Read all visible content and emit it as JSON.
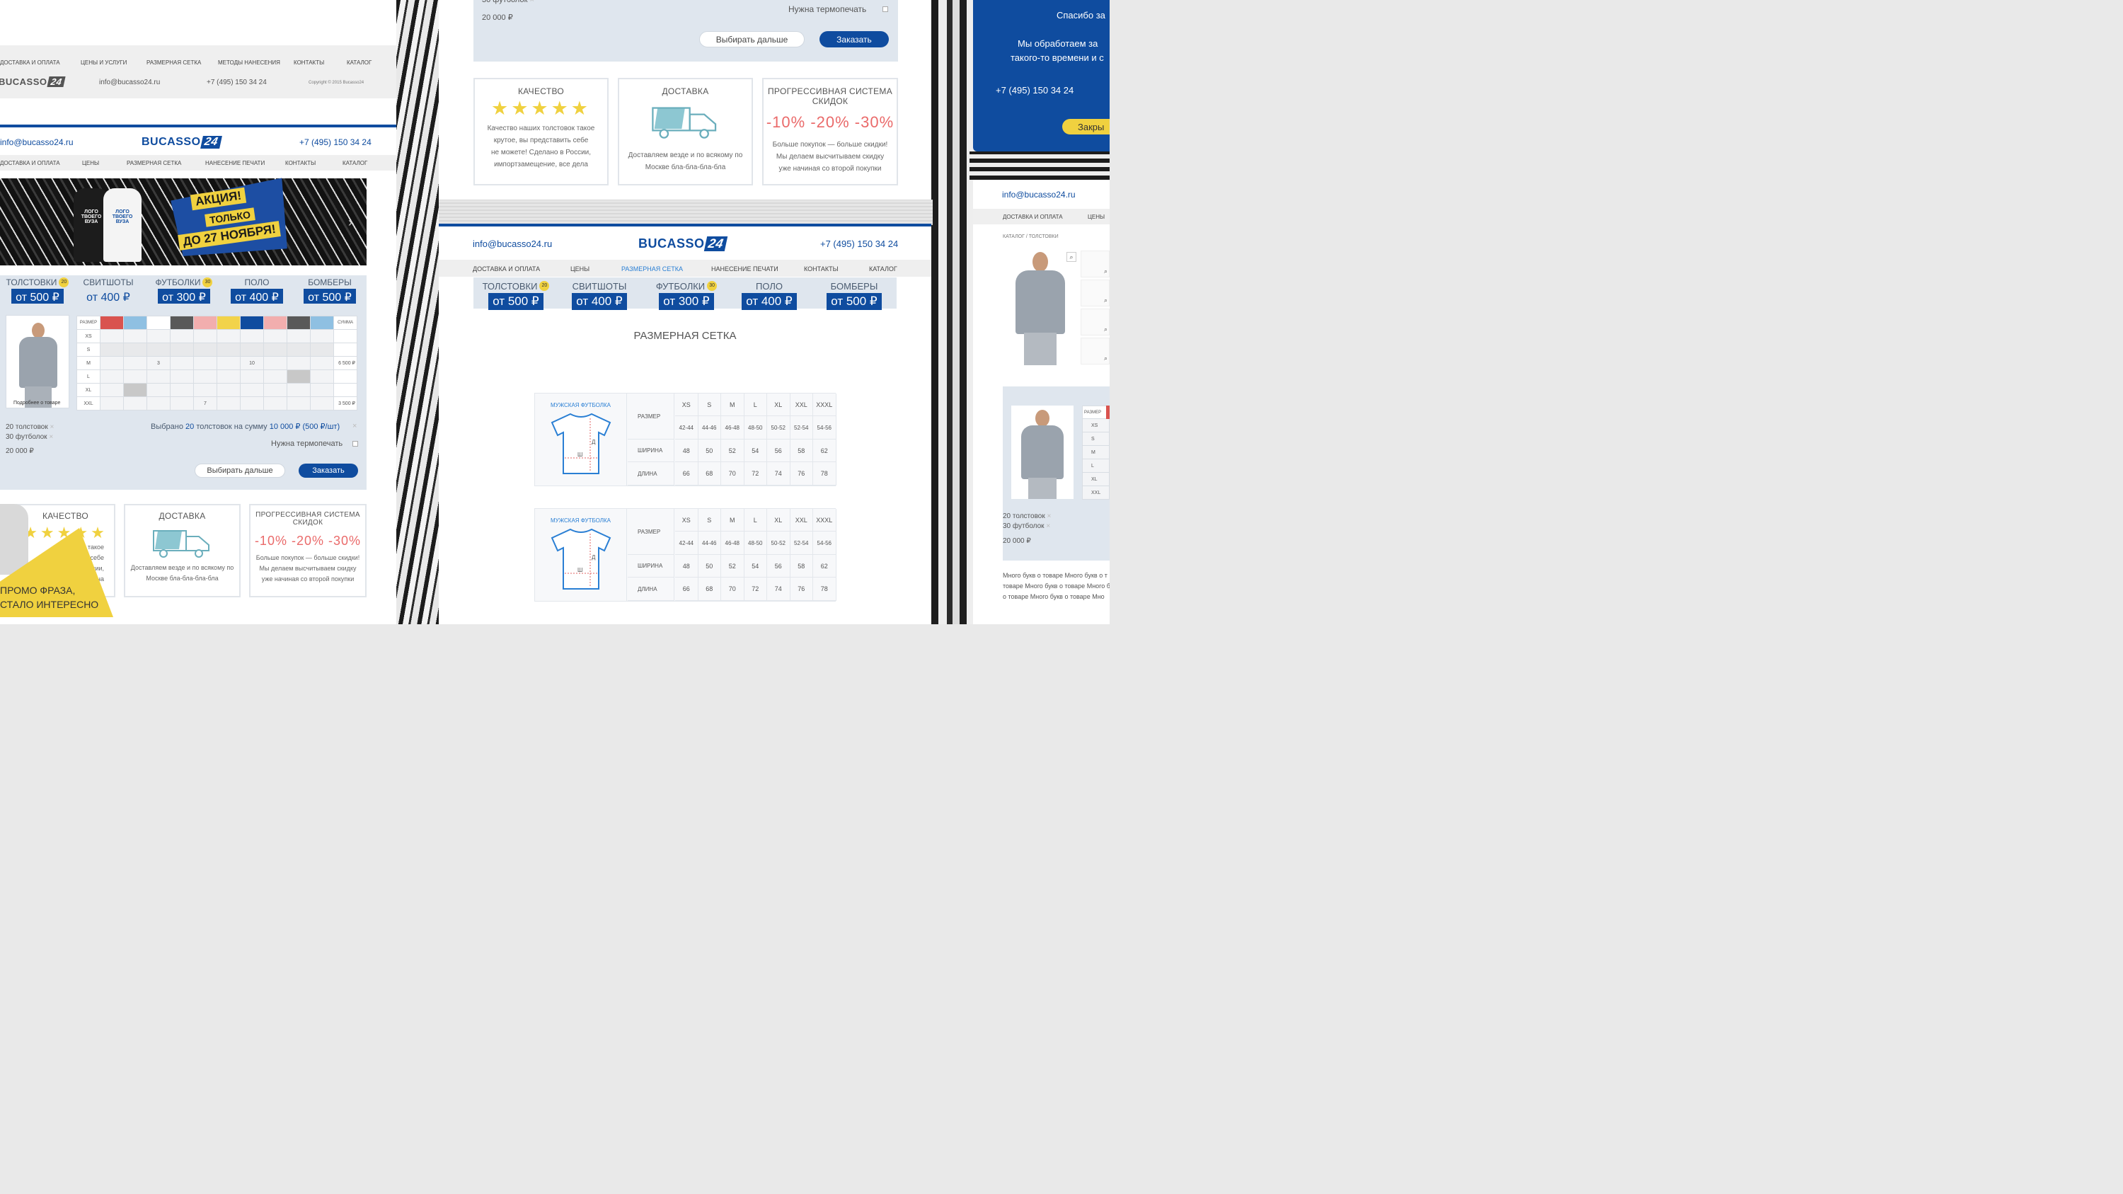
{
  "brand": {
    "name": "BUCASSO",
    "num": "24",
    "accent": "#0f4c9f",
    "yellow": "#f0d13f",
    "red": "#ea6a6a"
  },
  "contact": {
    "email": "info@bucasso24.ru",
    "phone": "+7 (495) 150 34 24",
    "copyright": "Copyright © 2015 Bucasso24"
  },
  "footer_nav": [
    "ДОСТАВКА И ОПЛАТА",
    "ЦЕНЫ И УСЛУГИ",
    "РАЗМЕРНАЯ СЕТКА",
    "МЕТОДЫ НАНЕСЕНИЯ",
    "КОНТАКТЫ",
    "КАТАЛОГ"
  ],
  "nav_left": [
    "ДОСТАВКА И ОПЛАТА",
    "ЦЕНЫ",
    "РАЗМЕРНАЯ СЕТКА",
    "НАНЕСЕНИЕ ПЕЧАТИ",
    "КОНТАКТЫ",
    "КАТАЛОГ"
  ],
  "nav_center": [
    "ДОСТАВКА И ОПЛАТА",
    "ЦЕНЫ",
    "РАЗМЕРНАЯ СЕТКА",
    "НАНЕСЕНИЕ ПЕЧАТИ",
    "КОНТАКТЫ",
    "КАТАЛОГ"
  ],
  "nav_right": [
    "ДОСТАВКА И ОПЛАТА",
    "ЦЕНЫ"
  ],
  "banner": {
    "line1": "АКЦИЯ!",
    "line2": "ТОЛЬКО",
    "line3": "ДО 27 НОЯБРЯ!",
    "logo_a": "ЛОГО",
    "logo_b": "ТВОЕГО",
    "logo_c": "ВУЗА"
  },
  "categories": [
    {
      "name": "ТОЛСТОВКИ",
      "price": "от 500 ₽",
      "badge": "20"
    },
    {
      "name": "СВИТШОТЫ",
      "price": "от 400 ₽",
      "badge": ""
    },
    {
      "name": "ФУТБОЛКИ",
      "price": "от 300 ₽",
      "badge": "30"
    },
    {
      "name": "ПОЛО",
      "price": "от 400 ₽",
      "badge": ""
    },
    {
      "name": "БОМБЕРЫ",
      "price": "от 500 ₽",
      "badge": ""
    }
  ],
  "order_grid": {
    "size_header": "РАЗМЕР",
    "sum_header": "СУММА",
    "colors": [
      "#d9534f",
      "#8fc0e2",
      "#ffffff",
      "#595959",
      "#f2aeae",
      "#f2d34a",
      "#0f4c9f",
      "#f2aeae",
      "#595959",
      "#8fc0e2"
    ],
    "rows": [
      {
        "size": "XS",
        "cells": [
          "",
          "",
          "",
          "",
          "",
          "",
          "",
          "",
          "",
          ""
        ],
        "sum": ""
      },
      {
        "size": "S",
        "cells": [
          "",
          "",
          "",
          "",
          "",
          "",
          "",
          "",
          "",
          ""
        ],
        "sum": ""
      },
      {
        "size": "M",
        "cells": [
          "",
          "",
          "3",
          "",
          "",
          "",
          "10",
          "",
          "",
          ""
        ],
        "sum": "6 500 ₽"
      },
      {
        "size": "L",
        "cells": [
          "",
          "",
          "",
          "",
          "",
          "",
          "",
          "",
          "",
          ""
        ],
        "sum": ""
      },
      {
        "size": "XL",
        "cells": [
          "",
          "",
          "",
          "",
          "",
          "",
          "",
          "",
          "",
          ""
        ],
        "sum": ""
      },
      {
        "size": "XXL",
        "cells": [
          "",
          "",
          "",
          "",
          "7",
          "",
          "",
          "",
          "",
          ""
        ],
        "sum": "3 500 ₽"
      }
    ]
  },
  "product": {
    "more": "Подробнее о товаре"
  },
  "order_summary": {
    "line1": "20 толстовок",
    "line2": "30 футболок",
    "total": "20 000 ₽",
    "selected_pre": "Выбрано ",
    "selected_qty": "20",
    "selected_mid": " толстовок на сумму ",
    "selected_sum": "10 000 ₽",
    "selected_unit": "(500 ₽/шт)",
    "thermo": "Нужна термопечать",
    "btn_continue": "Выбирать дальше",
    "btn_order": "Заказать"
  },
  "features": {
    "quality_title": "КАЧЕСТВО",
    "quality_text": [
      "Качество наших толстовок такое",
      "крутое, вы представить себе",
      "не можете! Сделано в России,",
      "импортзамещение, все дела"
    ],
    "quality_left_text": [
      "толстовок такое",
      "ить себе",
      "оссии,",
      "на"
    ],
    "delivery_title": "ДОСТАВКА",
    "delivery_text": [
      "Доставляем везде и по всякому по",
      "Москве бла-бла-бла-бла"
    ],
    "discount_title": [
      "ПРОГРЕССИВНАЯ СИСТЕМА",
      "СКИДОК"
    ],
    "discounts": [
      "-10%",
      "-20%",
      "-30%"
    ],
    "discount_text": [
      "Больше покупок — больше скидки!",
      "Мы делаем высчитываем скидку",
      "уже начиная со второй покупки"
    ]
  },
  "promo": {
    "line1": "ПРОМО ФРАЗА,",
    "line2": "СТАЛО ИНТЕРЕСНО"
  },
  "size_chart": {
    "title": "РАЗМЕРНАЯ СЕТКА",
    "tables": [
      {
        "product": "МУЖСКАЯ ФУТБОЛКА",
        "sizes": [
          "XS",
          "S",
          "M",
          "L",
          "XL",
          "XXL",
          "XXXL"
        ],
        "ru": [
          "42-44",
          "44-46",
          "46-48",
          "48-50",
          "50-52",
          "52-54",
          "54-56"
        ],
        "width": [
          "48",
          "50",
          "52",
          "54",
          "56",
          "58",
          "62"
        ],
        "length": [
          "66",
          "68",
          "70",
          "72",
          "74",
          "76",
          "78"
        ]
      },
      {
        "product": "МУЖСКАЯ ФУТБОЛКА",
        "sizes": [
          "XS",
          "S",
          "M",
          "L",
          "XL",
          "XXL",
          "XXXL"
        ],
        "ru": [
          "42-44",
          "44-46",
          "46-48",
          "48-50",
          "50-52",
          "52-54",
          "54-56"
        ],
        "width": [
          "48",
          "50",
          "52",
          "54",
          "56",
          "58",
          "62"
        ],
        "length": [
          "66",
          "68",
          "70",
          "72",
          "74",
          "76",
          "78"
        ]
      }
    ],
    "labels": {
      "size": "РАЗМЕР",
      "width": "ШИРИНА",
      "length": "ДЛИНА",
      "d": "Д",
      "w": "Ш"
    }
  },
  "thankyou": {
    "title": "Спасибо за",
    "line1": "Мы обработаем за",
    "line2": "такого-то времени и с",
    "phone": "+7 (495) 150 34 24",
    "close": "Закры"
  },
  "right_page": {
    "breadcrumb": "КАТАЛОГ / ТОЛСТОВКИ",
    "size_header": "РАЗМЕР",
    "sizes": [
      "XS",
      "S",
      "M",
      "L",
      "XL",
      "XXL"
    ],
    "line1": "20 толстовок",
    "line2": "30 футболок",
    "total": "20 000 ₽",
    "desc": [
      "Много букв о товаре Много букв о т",
      "товаре Много букв о товаре Много б",
      "о товаре Много букв о товаре Мно"
    ]
  }
}
